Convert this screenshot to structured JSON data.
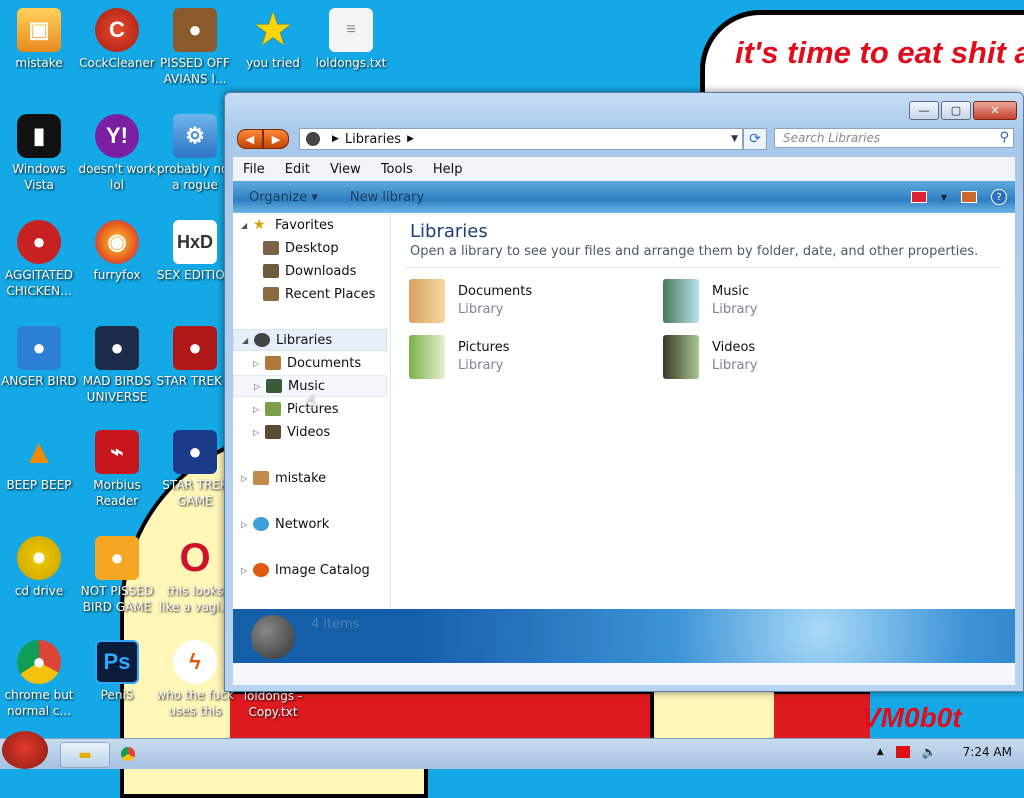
{
  "wallpaper": {
    "bubble_text": "it's time to eat shit and die and chew",
    "signature": "VM0b0t"
  },
  "desktop_icons": [
    {
      "label": "mistake"
    },
    {
      "label": "CockCleaner"
    },
    {
      "label": "PISSED OFF AVIANS I..."
    },
    {
      "label": "you tried"
    },
    {
      "label": "loldongs.txt"
    },
    {
      "label": "Windows Vista"
    },
    {
      "label": "doesn't work lol"
    },
    {
      "label": "probably not a rogue"
    },
    {
      "label": "AGGITATED CHICKEN..."
    },
    {
      "label": "furryfox"
    },
    {
      "label": "SEX EDITIOR"
    },
    {
      "label": "ANGER BIRD"
    },
    {
      "label": "MAD BIRDS UNIVERSE"
    },
    {
      "label": "STAR TREK 3"
    },
    {
      "label": "BEEP BEEP"
    },
    {
      "label": "Morbius Reader"
    },
    {
      "label": "STAR TREK GAME"
    },
    {
      "label": "cd drive"
    },
    {
      "label": "NOT PISSED BIRD GAME"
    },
    {
      "label": "this looks like a vagi..."
    },
    {
      "label": "chrome but normal c..."
    },
    {
      "label": "PeniS"
    },
    {
      "label": "who the fuck uses this"
    },
    {
      "label": "loldongs - Copy.txt"
    }
  ],
  "window": {
    "caption": {
      "minimize": "—",
      "maximize": "▢",
      "close": "✕"
    },
    "address": {
      "crumb": "Libraries"
    },
    "search": {
      "placeholder": "Search Libraries"
    },
    "menu": [
      "File",
      "Edit",
      "View",
      "Tools",
      "Help"
    ],
    "commands": {
      "organize": "Organize ▾",
      "new_library": "New library"
    },
    "nav": {
      "favorites": "Favorites",
      "desktop": "Desktop",
      "downloads": "Downloads",
      "recent": "Recent Places",
      "libraries": "Libraries",
      "documents": "Documents",
      "music": "Music",
      "pictures": "Pictures",
      "videos": "Videos",
      "mistake": "mistake",
      "network": "Network",
      "image_catalog": "Image Catalog"
    },
    "content": {
      "title": "Libraries",
      "subtitle": "Open a library to see your files and arrange them by folder, date, and other properties.",
      "libraries": [
        {
          "name": "Documents",
          "type": "Library"
        },
        {
          "name": "Music",
          "type": "Library"
        },
        {
          "name": "Pictures",
          "type": "Library"
        },
        {
          "name": "Videos",
          "type": "Library"
        }
      ]
    },
    "details": {
      "count": "4 items"
    }
  },
  "taskbar": {
    "clock": "7:24 AM"
  },
  "colors": {
    "desktop": "#14a9e6",
    "accent_red": "#e10c1c",
    "window_title_text": "#1e3d7a"
  }
}
